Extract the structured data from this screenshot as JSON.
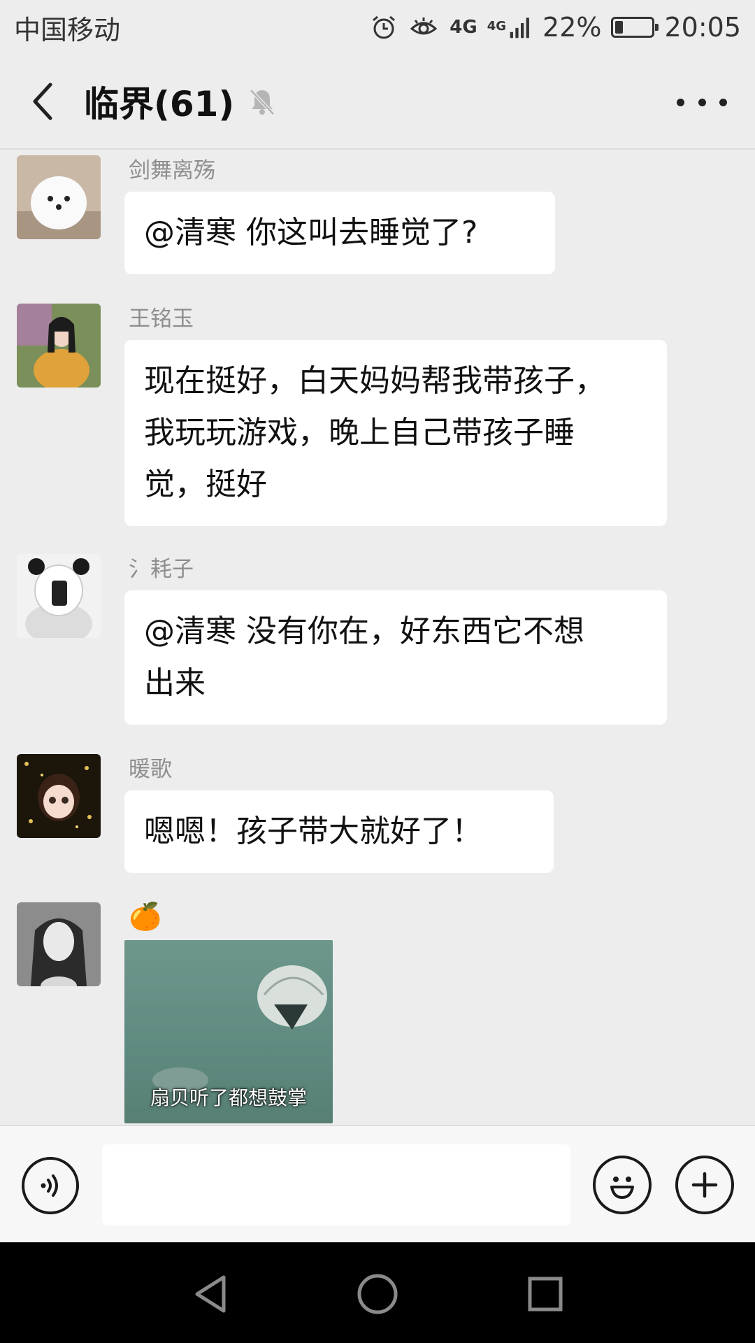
{
  "status": {
    "carrier": "中国移动",
    "network1": "4G",
    "network2": "4G",
    "battery_percent": "22%",
    "battery_level": 0.22,
    "time": "20:05",
    "icons": [
      "alarm-icon",
      "eye-icon",
      "signal-icon",
      "battery-icon"
    ]
  },
  "header": {
    "title": "临界(61)",
    "icons": [
      "back-arrow-icon",
      "mute-bell-icon",
      "more-dots-icon"
    ]
  },
  "messages": [
    {
      "sender": "剑舞离殇",
      "text": "@清寒 你这叫去睡觉了?"
    },
    {
      "sender": "王铭玉",
      "lines": [
        "现在挺好，白天妈妈帮我带孩子，",
        "我玩玩游戏，晚上自己带孩子睡",
        "觉，挺好"
      ]
    },
    {
      "sender": "氵耗子",
      "lines": [
        "@清寒 没有你在，好东西它不想",
        "出来"
      ]
    },
    {
      "sender": "暖歌",
      "text": "嗯嗯！孩子带大就好了！"
    },
    {
      "sender": "🍊",
      "sticker_caption": "扇贝听了都想鼓掌"
    }
  ],
  "input": {
    "value": "",
    "icons": [
      "voice-icon",
      "emoji-icon",
      "plus-icon"
    ]
  },
  "nav": {
    "icons": [
      "nav-back-icon",
      "nav-home-icon",
      "nav-recents-icon"
    ]
  },
  "colors": {
    "background": "#ededed",
    "bubble": "#ffffff",
    "sender_text": "#8e8e8e",
    "navbar": "#000000"
  }
}
